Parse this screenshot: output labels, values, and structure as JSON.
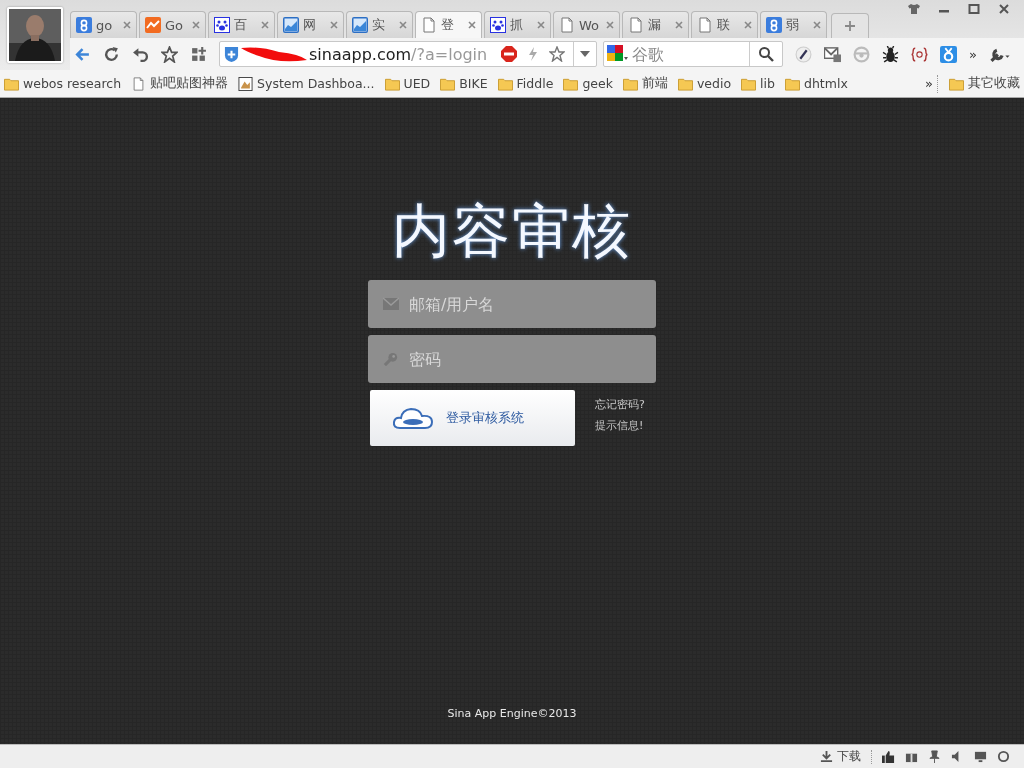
{
  "tabs": [
    {
      "title": "go",
      "kind": "google",
      "selected": false
    },
    {
      "title": "Go",
      "kind": "analytics",
      "selected": false
    },
    {
      "title": "百",
      "kind": "baidu",
      "selected": false
    },
    {
      "title": "网",
      "kind": "chart",
      "selected": false
    },
    {
      "title": "实",
      "kind": "chart",
      "selected": false
    },
    {
      "title": "登",
      "kind": "page",
      "selected": true
    },
    {
      "title": "抓",
      "kind": "baidu",
      "selected": false
    },
    {
      "title": "Wo",
      "kind": "page",
      "selected": false
    },
    {
      "title": "漏",
      "kind": "page",
      "selected": false
    },
    {
      "title": "联",
      "kind": "page",
      "selected": false
    },
    {
      "title": "弱",
      "kind": "google",
      "selected": false
    }
  ],
  "toolbar": {
    "url_host": "sinaapp.com",
    "url_path": "/?a=login",
    "search_placeholder": "谷歌",
    "extensions_overflow": "»"
  },
  "bookmarks": {
    "items": [
      {
        "label": "webos research",
        "kind": "folder"
      },
      {
        "label": "贴吧贴图神器",
        "kind": "page"
      },
      {
        "label": "System Dashboa...",
        "kind": "app"
      },
      {
        "label": "UED",
        "kind": "folder"
      },
      {
        "label": "BIKE",
        "kind": "folder"
      },
      {
        "label": "Fiddle",
        "kind": "folder"
      },
      {
        "label": "geek",
        "kind": "folder"
      },
      {
        "label": "前端",
        "kind": "folder"
      },
      {
        "label": "vedio",
        "kind": "folder"
      },
      {
        "label": "lib",
        "kind": "folder"
      },
      {
        "label": "dhtmlx",
        "kind": "folder"
      }
    ],
    "overflow": "»",
    "other": "其它收藏"
  },
  "page": {
    "title": "内容审核",
    "username_placeholder": "邮箱/用户名",
    "password_placeholder": "密码",
    "login_button": "登录审核系统",
    "forgot_link": "忘记密码?",
    "hint_link": "提示信息!",
    "footer": "Sina App Engine©2013"
  },
  "status_bar": {
    "downloads": "下载"
  }
}
